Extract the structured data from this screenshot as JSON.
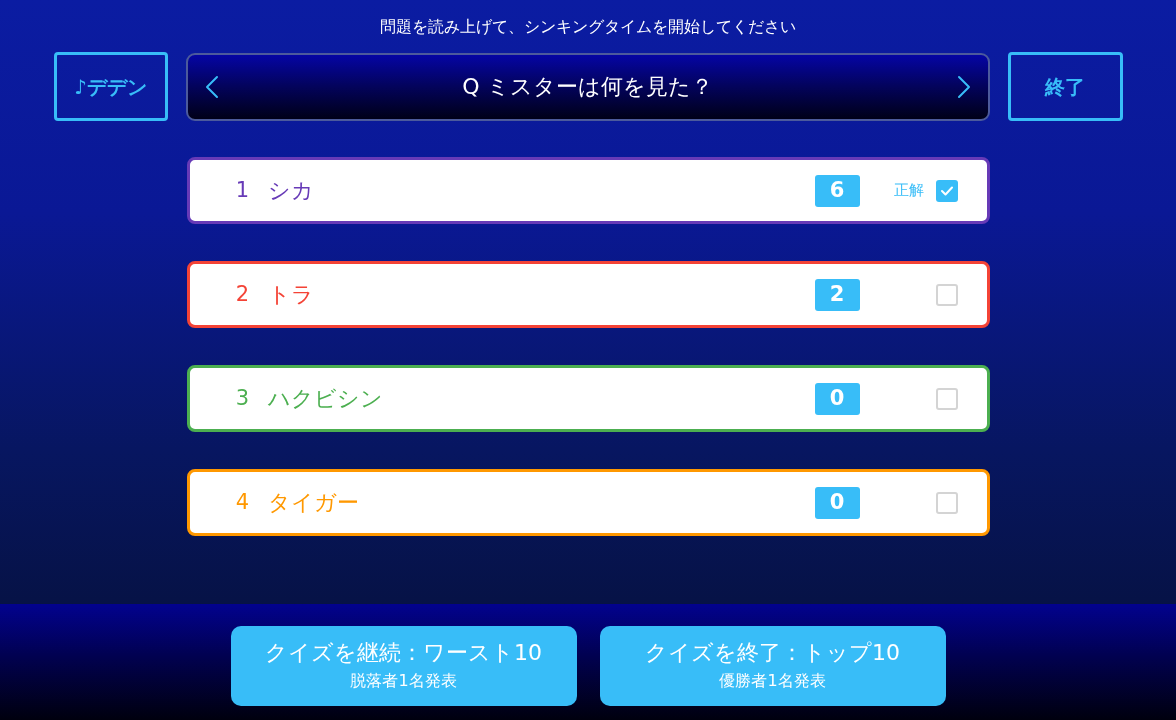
{
  "instruction": "問題を読み上げて、シンキングタイムを開始してください",
  "header": {
    "sound_button": "♪デデン",
    "question": "Q ミスターは何を見た？",
    "end_button": "終了"
  },
  "choices": [
    {
      "number": "1",
      "label": "シカ",
      "color": "#673ab7",
      "count": "6",
      "correct_label": "正解",
      "checked": true
    },
    {
      "number": "2",
      "label": "トラ",
      "color": "#f44336",
      "count": "2",
      "checked": false
    },
    {
      "number": "3",
      "label": "ハクビシン",
      "color": "#4caf50",
      "count": "0",
      "checked": false
    },
    {
      "number": "4",
      "label": "タイガー",
      "color": "#ff9800",
      "count": "0",
      "checked": false
    }
  ],
  "footer": {
    "buttons": [
      {
        "title": "クイズを継続：ワースト10",
        "subtitle": "脱落者1名発表"
      },
      {
        "title": "クイズを終了：トップ10",
        "subtitle": "優勝者1名発表"
      }
    ]
  }
}
